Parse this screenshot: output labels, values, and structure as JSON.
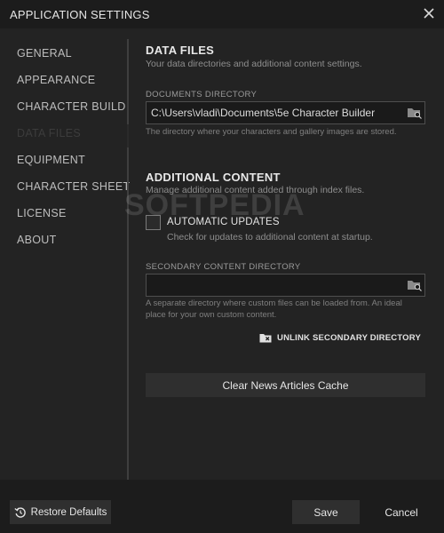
{
  "window": {
    "title": "APPLICATION SETTINGS",
    "close_icon": "close-icon"
  },
  "sidebar": {
    "items": [
      {
        "label": "GENERAL",
        "active": false
      },
      {
        "label": "APPEARANCE",
        "active": false
      },
      {
        "label": "CHARACTER BUILD",
        "active": false
      },
      {
        "label": "DATA FILES",
        "active": true
      },
      {
        "label": "EQUIPMENT",
        "active": false
      },
      {
        "label": "CHARACTER SHEET",
        "active": false
      },
      {
        "label": "LICENSE",
        "active": false
      },
      {
        "label": "ABOUT",
        "active": false
      }
    ]
  },
  "data_files": {
    "heading": "DATA FILES",
    "subtitle": "Your data directories and additional content settings.",
    "documents_label": "DOCUMENTS DIRECTORY",
    "documents_value": "C:\\Users\\vladi\\Documents\\5e Character Builder",
    "documents_help": "The directory where your characters and gallery images are stored."
  },
  "additional_content": {
    "heading": "ADDITIONAL CONTENT",
    "subtitle": "Manage additional content added through index files.",
    "auto_updates_label": "AUTOMATIC UPDATES",
    "auto_updates_checked": false,
    "auto_updates_help": "Check for updates to additional content at startup.",
    "secondary_label": "SECONDARY CONTENT DIRECTORY",
    "secondary_value": "",
    "secondary_help": "A separate directory where custom files can be loaded from. An ideal place for your own custom content.",
    "unlink_label": "UNLINK SECONDARY DIRECTORY",
    "clear_cache_label": "Clear News Articles Cache"
  },
  "footer": {
    "restore_label": "Restore Defaults",
    "save_label": "Save",
    "cancel_label": "Cancel"
  },
  "watermark": {
    "text": "SOFTPEDIA"
  },
  "colors": {
    "background": "#232323",
    "titlebar": "#1c1c1c",
    "button": "#2f2f2f",
    "active_nav": "#3c3c3c"
  }
}
